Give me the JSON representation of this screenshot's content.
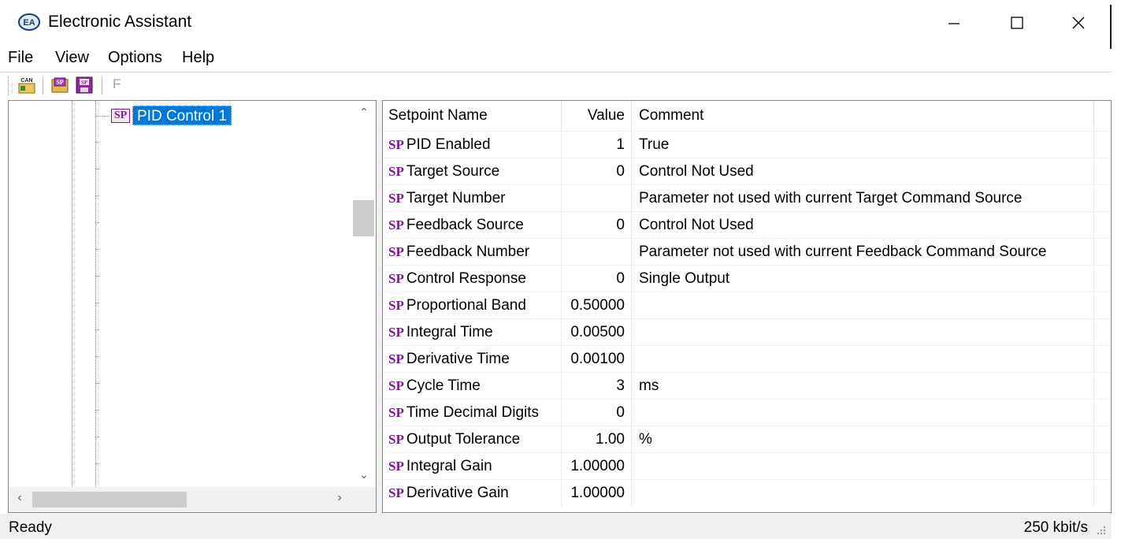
{
  "window": {
    "title": "Electronic Assistant",
    "app_icon": "ea-logo-icon",
    "controls": [
      "minimize-icon",
      "maximize-icon",
      "close-icon"
    ]
  },
  "menu": {
    "items": [
      "File",
      "View",
      "Options",
      "Help"
    ]
  },
  "toolbar": {
    "buttons": [
      {
        "name": "can-connect-icon",
        "label": "CAN"
      },
      {
        "name": "open-setpoint-file-icon",
        "label": "SP"
      },
      {
        "name": "save-setpoint-file-icon",
        "label": "SP"
      }
    ],
    "f_label": "F"
  },
  "tree": {
    "selected_node": {
      "icon_label": "SP",
      "label": "PID Control 1"
    }
  },
  "grid": {
    "columns": {
      "name": "Setpoint Name",
      "value": "Value",
      "comment": "Comment"
    },
    "row_icon": "SP",
    "rows": [
      {
        "name": "PID Enabled",
        "value": "1",
        "comment": "True"
      },
      {
        "name": "Target Source",
        "value": "0",
        "comment": "Control Not Used"
      },
      {
        "name": "Target Number",
        "value": "",
        "comment": "Parameter not used with current Target Command Source"
      },
      {
        "name": "Feedback Source",
        "value": "0",
        "comment": "Control Not Used"
      },
      {
        "name": "Feedback Number",
        "value": "",
        "comment": "Parameter not used with current Feedback Command Source"
      },
      {
        "name": "Control Response",
        "value": "0",
        "comment": "Single Output"
      },
      {
        "name": "Proportional Band",
        "value": "0.50000",
        "comment": ""
      },
      {
        "name": "Integral Time",
        "value": "0.00500",
        "comment": ""
      },
      {
        "name": "Derivative Time",
        "value": "0.00100",
        "comment": ""
      },
      {
        "name": "Cycle Time",
        "value": "3",
        "comment": "ms"
      },
      {
        "name": "Time Decimal Digits",
        "value": "0",
        "comment": ""
      },
      {
        "name": "Output Tolerance",
        "value": "1.00",
        "comment": "%"
      },
      {
        "name": "Integral Gain",
        "value": "1.00000",
        "comment": ""
      },
      {
        "name": "Derivative Gain",
        "value": "1.00000",
        "comment": ""
      }
    ]
  },
  "status": {
    "left": "Ready",
    "right": "250 kbit/s"
  }
}
